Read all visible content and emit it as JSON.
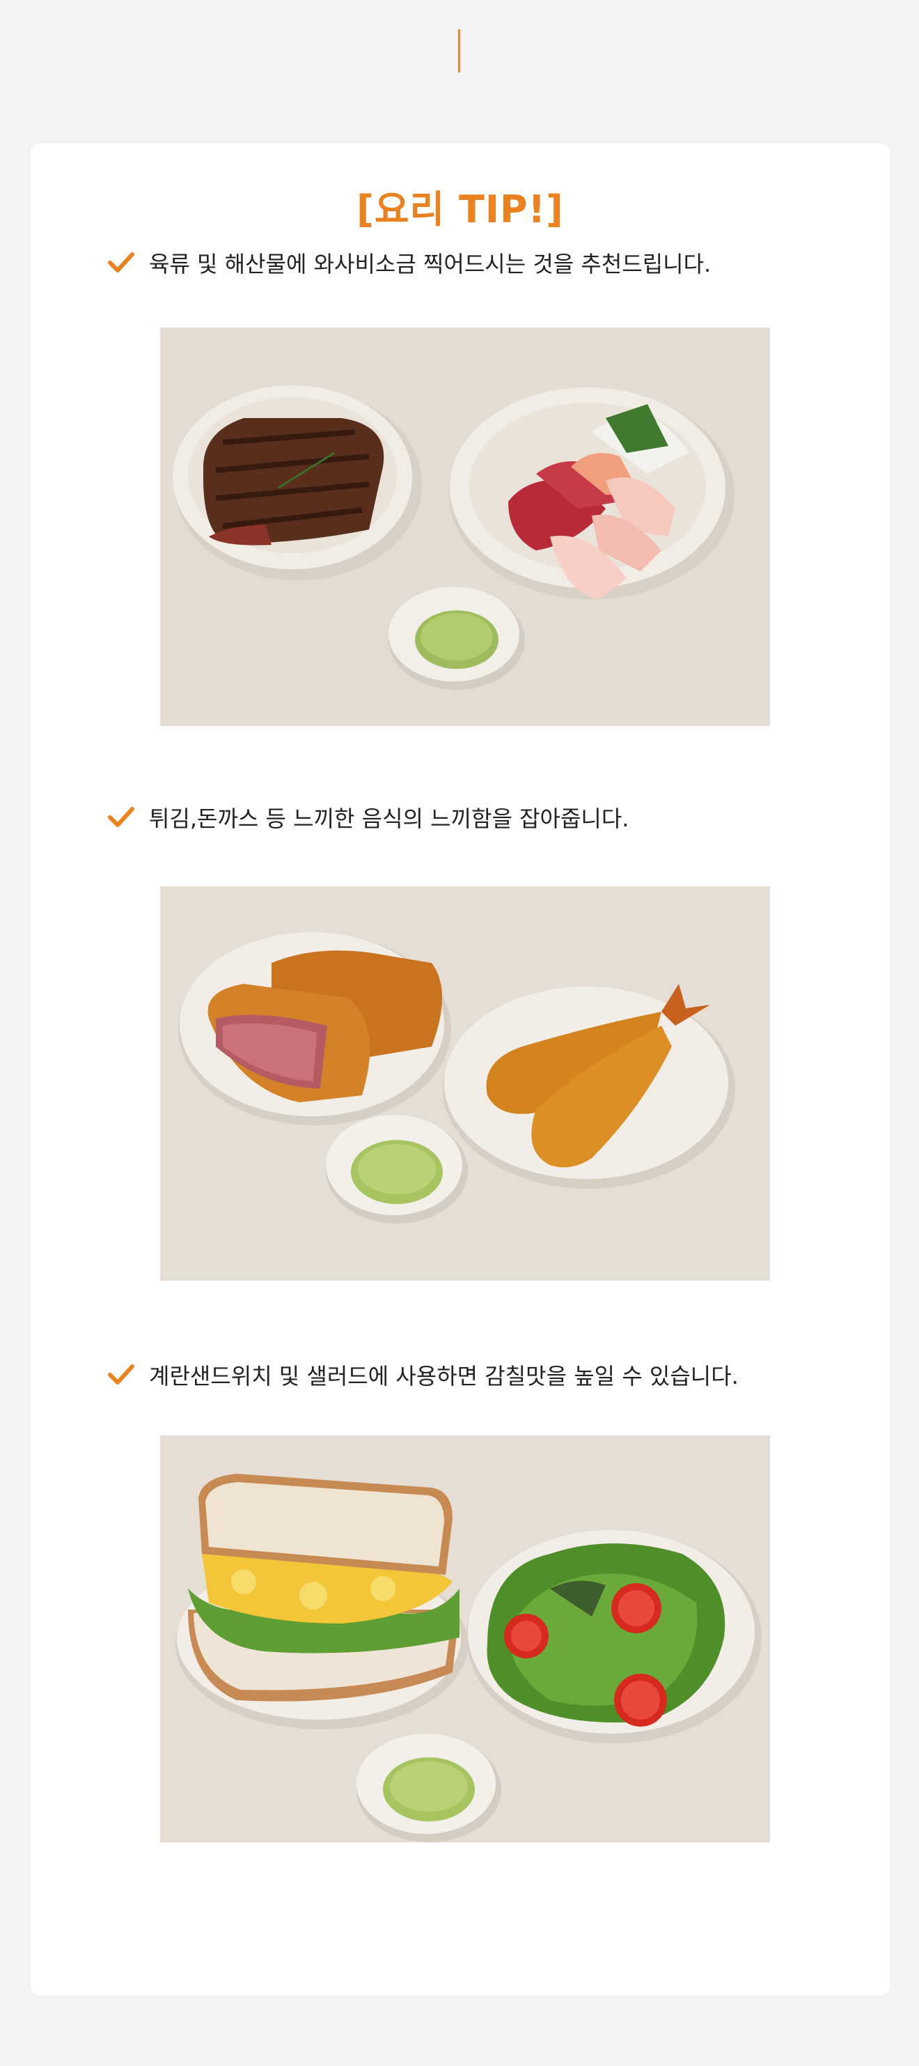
{
  "title": "[요리 TIP!]",
  "tips": [
    {
      "text": "육류 및 해산물에 와사비소금 찍어드시는 것을 추천드립니다.",
      "photo": "steak-and-sashimi-with-wasabi-salt"
    },
    {
      "text": "튀김,돈까스 등 느끼한 음식의 느끼함을 잡아줍니다.",
      "photo": "tonkatsu-and-fried-shrimp-with-wasabi-salt"
    },
    {
      "text": "계란샌드위치 및 샐러드에 사용하면 감칠맛을 높일 수 있습니다.",
      "photo": "egg-sandwich-and-salad-with-wasabi-salt"
    }
  ],
  "colors": {
    "accent": "#e9821f",
    "background": "#f3f3f3",
    "card": "#ffffff"
  },
  "icons": {
    "tip_marker": "check-icon"
  }
}
